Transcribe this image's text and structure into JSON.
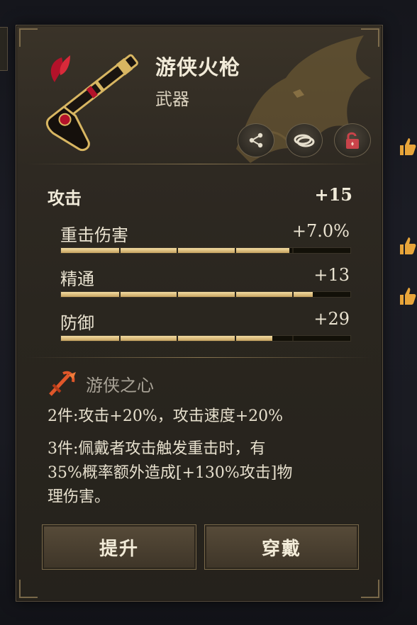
{
  "item": {
    "name": "游侠火枪",
    "type": "武器"
  },
  "actions": {
    "share_icon": "share-icon",
    "compare_icon": "compare-rings-icon",
    "lock_icon": "unlock-icon"
  },
  "main_stat": {
    "label": "攻击",
    "value": "+15"
  },
  "sub_stats": [
    {
      "label": "重击伤害",
      "value": "+7.0%",
      "fill_fraction": 0.79
    },
    {
      "label": "精通",
      "value": "+13",
      "fill_fraction": 0.87
    },
    {
      "label": "防御",
      "value": "+29",
      "fill_fraction": 0.73
    }
  ],
  "set_bonus": {
    "name": "游侠之心",
    "lines": [
      "2件:攻击+20%，攻击速度+20%",
      "3件:佩戴者攻击触发重击时，有",
      "35%概率额外造成[+130%攻击]物",
      "理伤害。"
    ]
  },
  "buttons": {
    "upgrade": "提升",
    "equip": "穿戴"
  },
  "colors": {
    "accent_gold": "#c7a35f",
    "panel": "#2e2922",
    "set_name": "#a8a296",
    "like_icon": "#e8a53a"
  }
}
